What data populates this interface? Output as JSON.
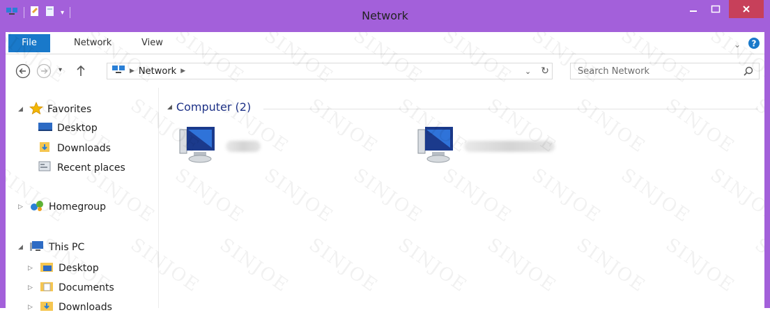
{
  "window": {
    "title": "Network"
  },
  "ribbon": {
    "tabs": [
      "File",
      "Network",
      "View"
    ]
  },
  "address": {
    "path": [
      "Network"
    ],
    "search_placeholder": "Search Network"
  },
  "nav": {
    "favorites_label": "Favorites",
    "favorites": [
      "Desktop",
      "Downloads",
      "Recent places"
    ],
    "homegroup_label": "Homegroup",
    "thispc_label": "This PC",
    "thispc": [
      "Desktop",
      "Documents",
      "Downloads"
    ]
  },
  "content": {
    "group_label": "Computer (2)"
  },
  "watermark_text": "SINJOE",
  "colors": {
    "frame": "#a360da",
    "file_tab": "#1979ca",
    "close": "#c7405a",
    "group_header": "#1e3287"
  }
}
